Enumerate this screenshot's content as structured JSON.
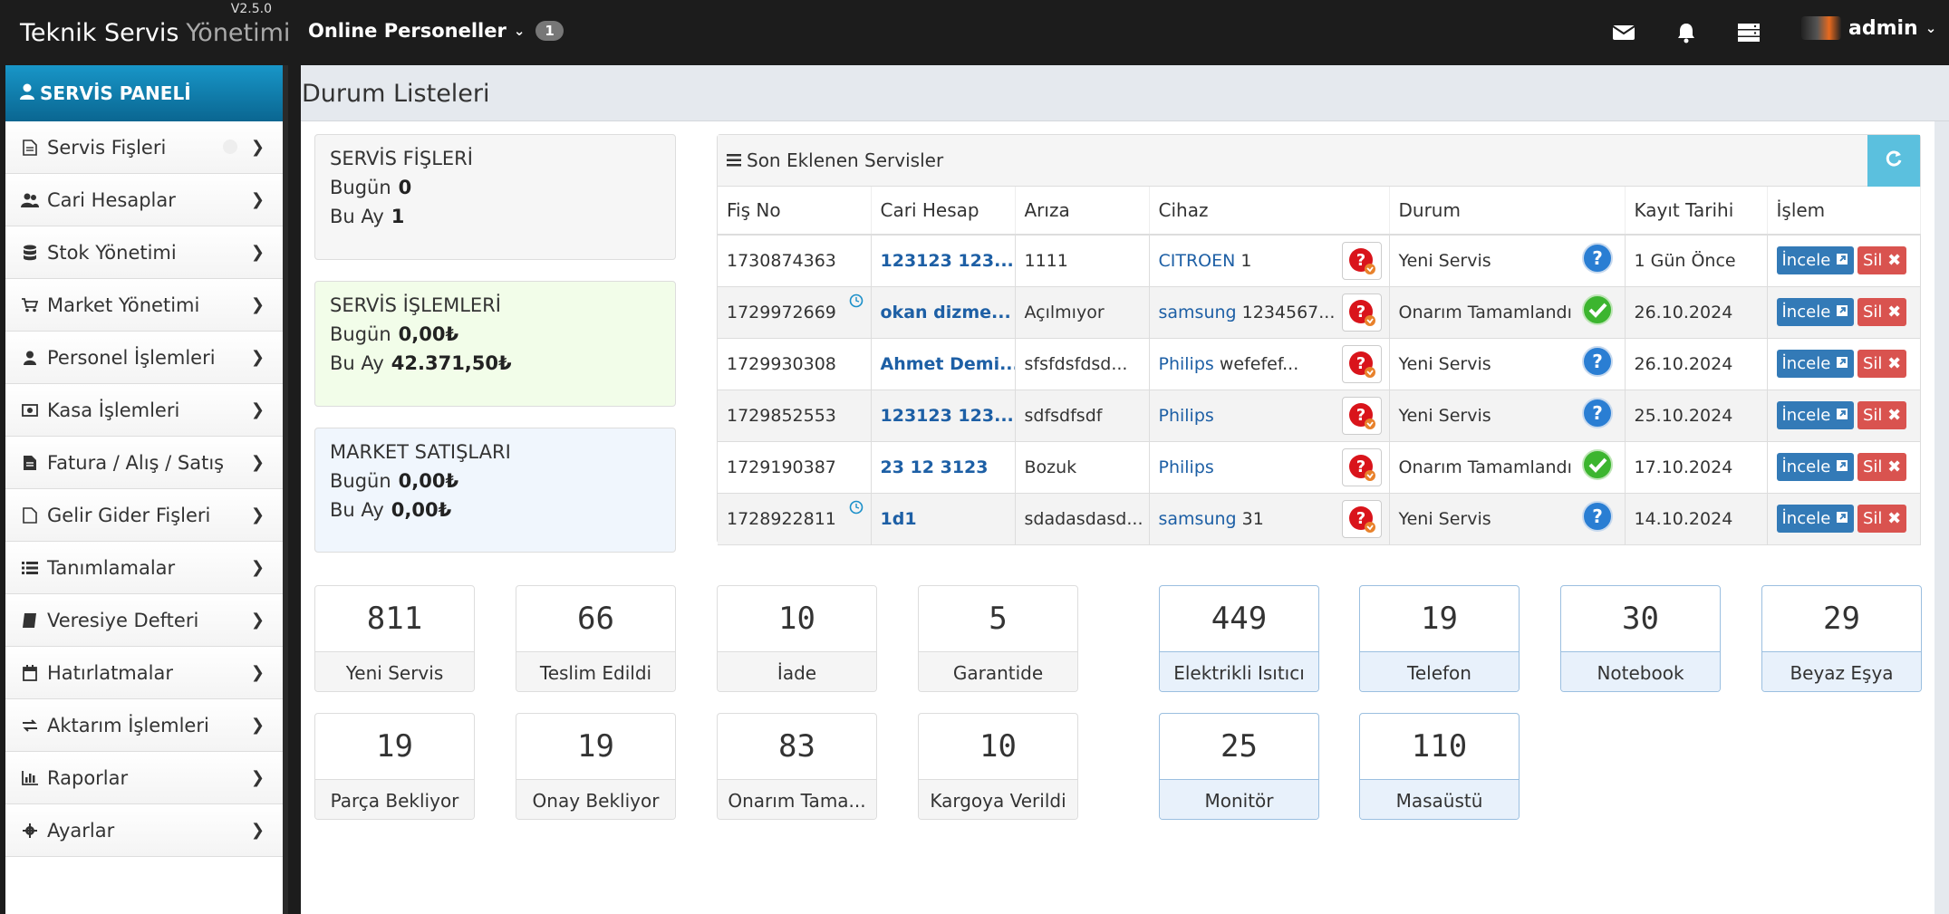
{
  "app": {
    "title_main": "Teknik Servis",
    "title_sub": "Yönetimi",
    "version": "V2.5.0"
  },
  "topbar": {
    "online_label": "Online Personeller",
    "online_count": "1",
    "user_name": "admin",
    "icons": [
      "envelope-icon",
      "bell-icon",
      "server-icon"
    ]
  },
  "sidebar": {
    "header": "SERVİS PANELİ",
    "items": [
      {
        "label": "Servis Fişleri",
        "icon": "file-icon"
      },
      {
        "label": "Cari Hesaplar",
        "icon": "users-icon"
      },
      {
        "label": "Stok Yönetimi",
        "icon": "database-icon"
      },
      {
        "label": "Market Yönetimi",
        "icon": "cart-icon"
      },
      {
        "label": "Personel İşlemleri",
        "icon": "user-icon"
      },
      {
        "label": "Kasa İşlemleri",
        "icon": "money-icon"
      },
      {
        "label": "Fatura / Alış / Satış",
        "icon": "invoice-icon"
      },
      {
        "label": "Gelir Gider Fişleri",
        "icon": "document-icon"
      },
      {
        "label": "Tanımlamalar",
        "icon": "list-icon"
      },
      {
        "label": "Veresiye Defteri",
        "icon": "book-icon"
      },
      {
        "label": "Hatırlatmalar",
        "icon": "calendar-icon"
      },
      {
        "label": "Aktarım İşlemleri",
        "icon": "transfer-icon"
      },
      {
        "label": "Raporlar",
        "icon": "bar-chart-icon"
      },
      {
        "label": "Ayarlar",
        "icon": "gear-icon"
      }
    ]
  },
  "page": {
    "title": "Durum Listeleri"
  },
  "stats": {
    "servis_fisleri": {
      "title": "SERVİS FİŞLERİ",
      "today_label": "Bugün",
      "today": "0",
      "month_label": "Bu Ay",
      "month": "1"
    },
    "servis_islemleri": {
      "title": "SERVİS İŞLEMLERİ",
      "today_label": "Bugün",
      "today": "0,00₺",
      "month_label": "Bu Ay",
      "month": "42.371,50₺"
    },
    "market_satislari": {
      "title": "MARKET SATIŞLARI",
      "today_label": "Bugün",
      "today": "0,00₺",
      "month_label": "Bu Ay",
      "month": "0,00₺"
    }
  },
  "recent": {
    "title": "Son Eklenen Servisler",
    "columns": [
      "Fiş No",
      "Cari Hesap",
      "Arıza",
      "Cihaz",
      "Durum",
      "Kayıt Tarihi",
      "İşlem"
    ],
    "btn_incele": "İncele",
    "btn_sil": "Sil",
    "rows": [
      {
        "fis": "1730874363",
        "cari": "123123 123...",
        "ariza": "1111",
        "brand": "CITROEN",
        "model": "1",
        "durum": "Yeni Servis",
        "status": "new",
        "tarih": "1 Gün Önce",
        "clock": false
      },
      {
        "fis": "1729972669",
        "cari": "okan dizme...",
        "ariza": "Açılmıyor",
        "brand": "samsung",
        "model": "1234567...",
        "durum": "Onarım Tamamlandı",
        "status": "done",
        "tarih": "26.10.2024",
        "clock": true
      },
      {
        "fis": "1729930308",
        "cari": "Ahmet Demi...",
        "ariza": "sfsfdsfdsd...",
        "brand": "Philips",
        "model": "wefefef...",
        "durum": "Yeni Servis",
        "status": "new",
        "tarih": "26.10.2024",
        "clock": false
      },
      {
        "fis": "1729852553",
        "cari": "123123 123...",
        "ariza": "sdfsdfsdf",
        "brand": "Philips",
        "model": "",
        "durum": "Yeni Servis",
        "status": "new",
        "tarih": "25.10.2024",
        "clock": false
      },
      {
        "fis": "1729190387",
        "cari": "23 12 3123",
        "ariza": "Bozuk",
        "brand": "Philips",
        "model": "",
        "durum": "Onarım Tamamlandı",
        "status": "done",
        "tarih": "17.10.2024",
        "clock": false
      },
      {
        "fis": "1728922811",
        "cari": "1d1",
        "ariza": "sdadasdasd...",
        "brand": "samsung",
        "model": "31",
        "durum": "Yeni Servis",
        "status": "new",
        "tarih": "14.10.2024",
        "clock": true
      }
    ]
  },
  "status_tiles": [
    {
      "count": "811",
      "label": "Yeni Servis"
    },
    {
      "count": "66",
      "label": "Teslim Edildi"
    },
    {
      "count": "10",
      "label": "İade"
    },
    {
      "count": "5",
      "label": "Garantide"
    },
    {
      "count": "19",
      "label": "Parça Bekliyor"
    },
    {
      "count": "19",
      "label": "Onay Bekliyor"
    },
    {
      "count": "83",
      "label": "Onarım Tama..."
    },
    {
      "count": "10",
      "label": "Kargoya Verildi"
    }
  ],
  "device_tiles": [
    {
      "count": "449",
      "label": "Elektrikli Isıtıcı"
    },
    {
      "count": "19",
      "label": "Telefon"
    },
    {
      "count": "30",
      "label": "Notebook"
    },
    {
      "count": "29",
      "label": "Beyaz Eşya"
    },
    {
      "count": "25",
      "label": "Monitör"
    },
    {
      "count": "110",
      "label": "Masaüstü"
    }
  ]
}
